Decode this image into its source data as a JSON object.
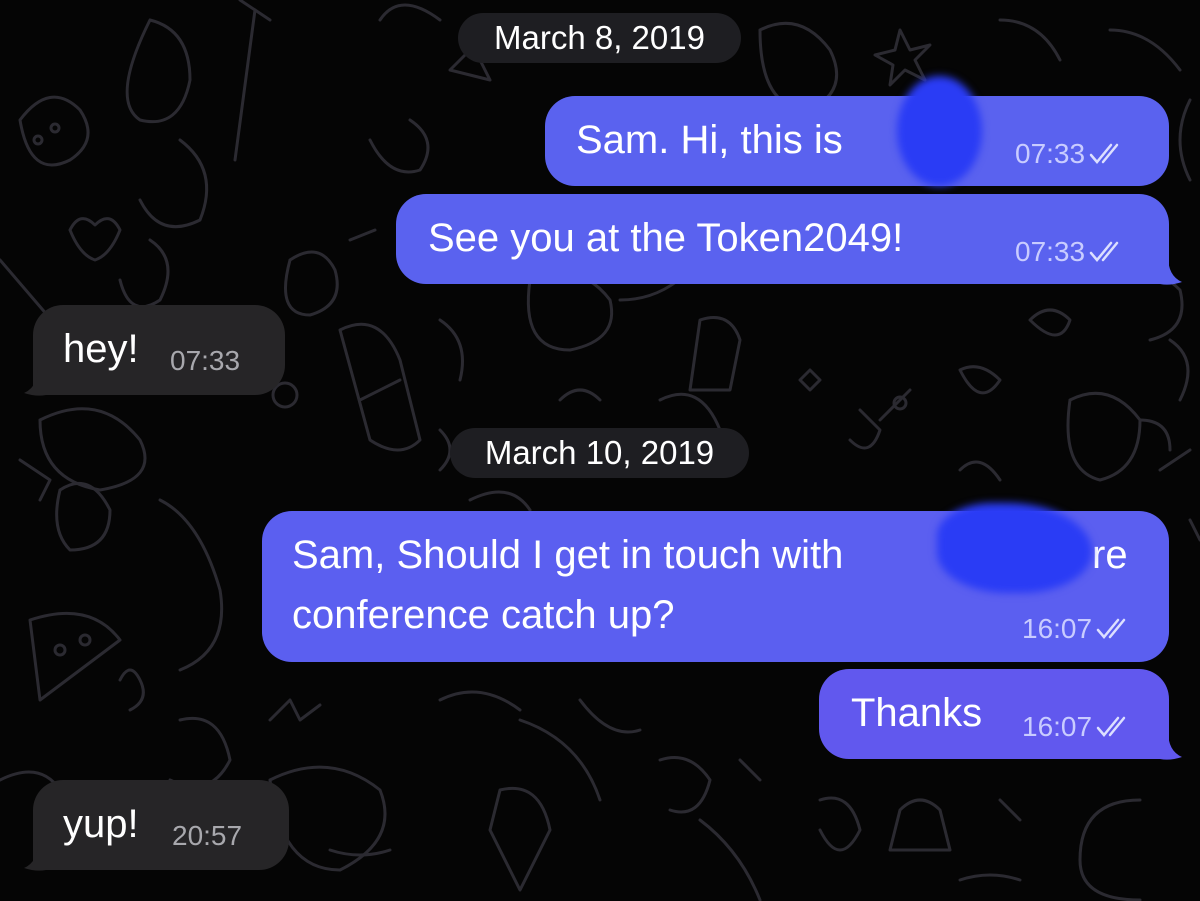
{
  "dates": [
    "March 8, 2019",
    "March 10, 2019"
  ],
  "messages": [
    {
      "direction": "outgoing",
      "text": "Sam. Hi, this is",
      "time": "07:33",
      "status": "read-double-check"
    },
    {
      "direction": "outgoing",
      "text": "See you at the Token2049!",
      "time": "07:33",
      "status": "read-double-check"
    },
    {
      "direction": "incoming",
      "text": "hey!",
      "time": "07:33"
    },
    {
      "direction": "outgoing",
      "text_line1": "Sam, Should I get in touch with",
      "text_line1_end": "re",
      "text_line2": "conference catch up?",
      "time": "16:07",
      "status": "read-double-check"
    },
    {
      "direction": "outgoing",
      "text": "Thanks",
      "time": "16:07",
      "status": "read-double-check"
    },
    {
      "direction": "incoming",
      "text": "yup!",
      "time": "20:57"
    }
  ],
  "colors": {
    "background": "#050505",
    "outgoing_bubble": "#5a62ef",
    "incoming_bubble": "#262527",
    "date_pill": "#1e1e22",
    "redaction": "#2a3cf5"
  }
}
